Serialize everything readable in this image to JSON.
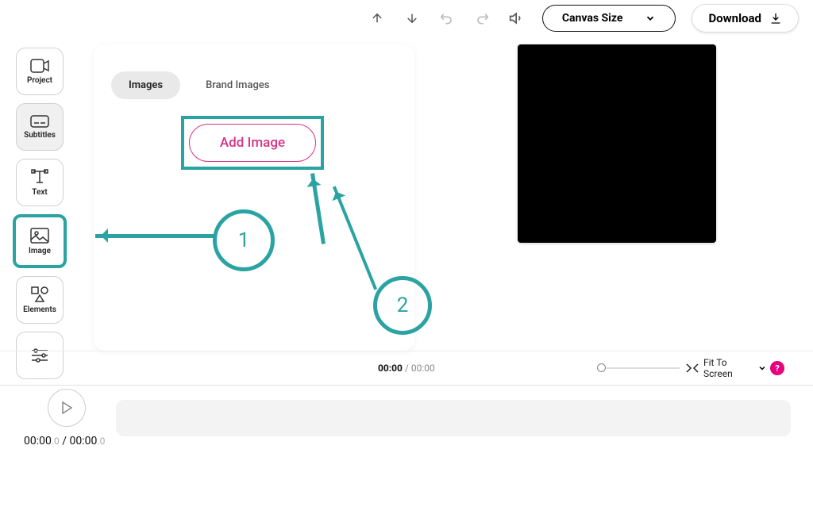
{
  "topbar": {
    "canvas_size": "Canvas Size",
    "download": "Download"
  },
  "sidebar": {
    "items": [
      {
        "label": "Project"
      },
      {
        "label": "Subtitles"
      },
      {
        "label": "Text"
      },
      {
        "label": "Image"
      },
      {
        "label": "Elements"
      }
    ]
  },
  "panel": {
    "tab_images": "Images",
    "tab_brand": "Brand Images",
    "add_image": "Add Image"
  },
  "annotation": {
    "step1": "1",
    "step2": "2"
  },
  "midbar": {
    "current": "00:00",
    "sep": " / ",
    "total": "00:00",
    "fit_label": "Fit To Screen",
    "help": "?"
  },
  "timeline": {
    "current": "00:00",
    "current_frac": ".0",
    "sep": " / ",
    "total": "00:00",
    "total_frac": ".0"
  }
}
